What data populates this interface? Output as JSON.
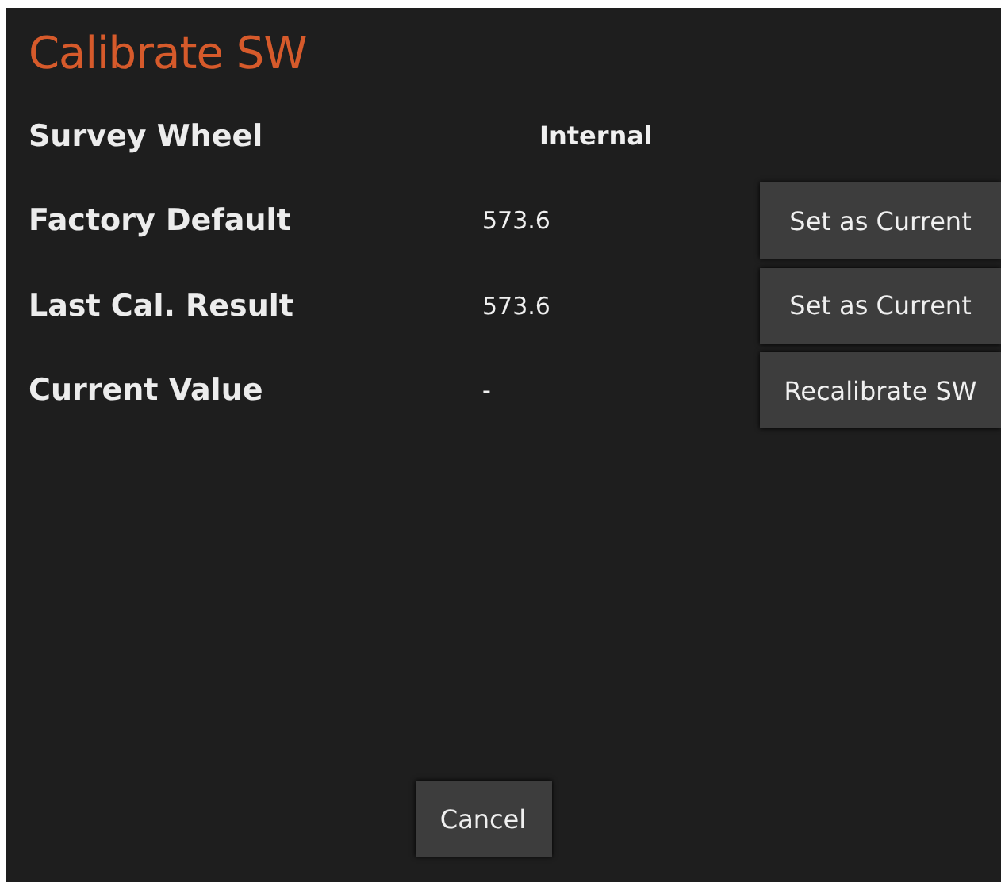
{
  "title": "Calibrate SW",
  "rows": [
    {
      "kind": "source",
      "label": "Survey Wheel",
      "value": "Internal"
    },
    {
      "kind": "value",
      "label": "Factory Default",
      "value": "573.6",
      "button": "Set as Current"
    },
    {
      "kind": "value",
      "label": "Last Cal. Result",
      "value": "573.6",
      "button": "Set as Current"
    },
    {
      "kind": "value",
      "label": "Current Value",
      "value": "-",
      "button": "Recalibrate SW"
    }
  ],
  "cancel_button": "Cancel"
}
